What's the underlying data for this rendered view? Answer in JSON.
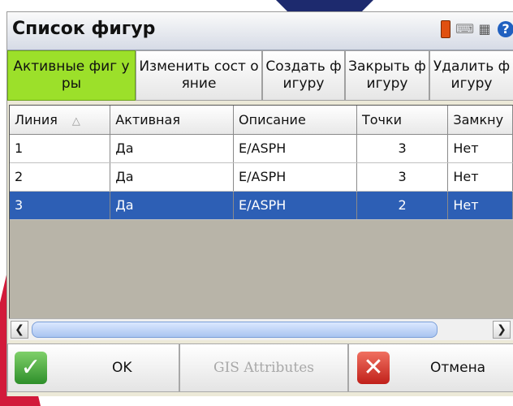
{
  "window": {
    "title": "Список фигур"
  },
  "system_icons": [
    "battery-icon",
    "keyboard-icon",
    "grid-icon",
    "help-icon"
  ],
  "toolbar": {
    "buttons": [
      {
        "label": "Активные фиг уры"
      },
      {
        "label": "Изменить сост ояние"
      },
      {
        "label": "Создать фигуру"
      },
      {
        "label": "Закрыть фигуру"
      },
      {
        "label": "Удалить фигуру"
      }
    ]
  },
  "table": {
    "columns": [
      "Линия",
      "Активная",
      "Описание",
      "Точки",
      "Замкну"
    ],
    "rows": [
      [
        "1",
        "Да",
        "E/ASPH",
        "3",
        "Нет"
      ],
      [
        "2",
        "Да",
        "E/ASPH",
        "3",
        "Нет"
      ],
      [
        "3",
        "Да",
        "E/ASPH",
        "2",
        "Нет"
      ]
    ],
    "selected_row_index": 2,
    "sort_indicator": "△"
  },
  "scrollbar": {
    "left_arrow": "❮",
    "right_arrow": "❯"
  },
  "bottom": {
    "ok_label": "OK",
    "gis_label": "GIS Attributes",
    "cancel_label": "Отмена"
  },
  "colors": {
    "active_button": "#9ce02a",
    "selected_row": "#2d5fb5",
    "accent_red": "#d21a3a",
    "accent_navy": "#1d2a6e"
  }
}
